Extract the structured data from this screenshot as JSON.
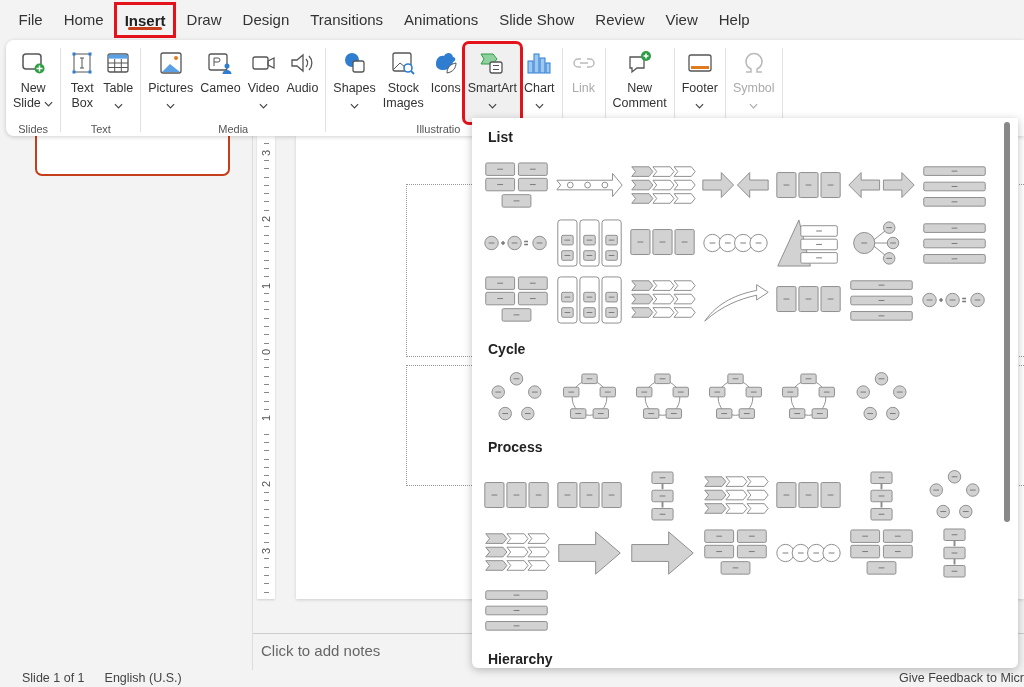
{
  "tabs": [
    {
      "label": "File",
      "selected": false,
      "annotated": false
    },
    {
      "label": "Home",
      "selected": false,
      "annotated": false
    },
    {
      "label": "Insert",
      "selected": true,
      "annotated": true
    },
    {
      "label": "Draw",
      "selected": false,
      "annotated": false
    },
    {
      "label": "Design",
      "selected": false,
      "annotated": false
    },
    {
      "label": "Transitions",
      "selected": false,
      "annotated": false
    },
    {
      "label": "Animations",
      "selected": false,
      "annotated": false
    },
    {
      "label": "Slide Show",
      "selected": false,
      "annotated": false
    },
    {
      "label": "Review",
      "selected": false,
      "annotated": false
    },
    {
      "label": "View",
      "selected": false,
      "annotated": false
    },
    {
      "label": "Help",
      "selected": false,
      "annotated": false
    }
  ],
  "ribbon": {
    "groups": [
      {
        "label": "Slides",
        "buttons": [
          {
            "label": "New\nSlide",
            "dropdown": true,
            "disabled": false,
            "pressed": false,
            "annotated": false
          }
        ]
      },
      {
        "label": "Text",
        "buttons": [
          {
            "label": "Text\nBox",
            "dropdown": false,
            "disabled": false,
            "pressed": false,
            "annotated": false
          },
          {
            "label": "Table",
            "dropdown": true,
            "disabled": false,
            "pressed": false,
            "annotated": false
          }
        ]
      },
      {
        "label": "Media",
        "buttons": [
          {
            "label": "Pictures",
            "dropdown": true,
            "disabled": false,
            "pressed": false,
            "annotated": false
          },
          {
            "label": "Cameo",
            "dropdown": false,
            "disabled": false,
            "pressed": false,
            "annotated": false
          },
          {
            "label": "Video",
            "dropdown": true,
            "disabled": false,
            "pressed": false,
            "annotated": false
          },
          {
            "label": "Audio",
            "dropdown": false,
            "disabled": false,
            "pressed": false,
            "annotated": false
          }
        ]
      },
      {
        "label": "Illustratio",
        "buttons": [
          {
            "label": "Shapes",
            "dropdown": true,
            "disabled": false,
            "pressed": false,
            "annotated": false
          },
          {
            "label": "Stock\nImages",
            "dropdown": false,
            "disabled": false,
            "pressed": false,
            "annotated": false
          },
          {
            "label": "Icons",
            "dropdown": false,
            "disabled": false,
            "pressed": false,
            "annotated": false
          },
          {
            "label": "SmartArt",
            "dropdown": true,
            "disabled": false,
            "pressed": true,
            "annotated": true
          },
          {
            "label": "Chart",
            "dropdown": true,
            "disabled": false,
            "pressed": false,
            "annotated": false
          }
        ]
      },
      {
        "buttons": [
          {
            "label": "Link",
            "dropdown": false,
            "disabled": true,
            "pressed": false,
            "annotated": false
          }
        ]
      },
      {
        "buttons": [
          {
            "label": "New\nComment",
            "dropdown": false,
            "disabled": false,
            "pressed": false,
            "annotated": false
          }
        ]
      },
      {
        "buttons": [
          {
            "label": "Footer",
            "dropdown": true,
            "disabled": false,
            "pressed": false,
            "annotated": false
          }
        ]
      },
      {
        "buttons": [
          {
            "label": "Symbol",
            "dropdown": true,
            "disabled": true,
            "pressed": false,
            "annotated": false
          }
        ]
      }
    ]
  },
  "gallery": {
    "sections": [
      {
        "title": "List",
        "items": [
          {
            "kind": "grid"
          },
          {
            "kind": "timeline"
          },
          {
            "kind": "chevrons"
          },
          {
            "kind": "facing"
          },
          {
            "kind": "boxes"
          },
          {
            "kind": "apart"
          },
          {
            "kind": "bars"
          },
          {
            "kind": "equation"
          },
          {
            "kind": "columns"
          },
          {
            "kind": "boxes"
          },
          {
            "kind": "circles"
          },
          {
            "kind": "pyramid"
          },
          {
            "kind": "hub"
          },
          {
            "kind": "bars"
          },
          {
            "kind": "grid"
          },
          {
            "kind": "columns"
          },
          {
            "kind": "chevrons"
          },
          {
            "kind": "curve"
          },
          {
            "kind": "boxes"
          },
          {
            "kind": "bars"
          },
          {
            "kind": "equation"
          }
        ]
      },
      {
        "title": "Cycle",
        "items": [
          {
            "kind": "ring"
          },
          {
            "kind": "boxring"
          },
          {
            "kind": "boxring"
          },
          {
            "kind": "boxring"
          },
          {
            "kind": "boxring"
          },
          {
            "kind": "ring"
          }
        ]
      },
      {
        "title": "Process",
        "items": [
          {
            "kind": "boxes"
          },
          {
            "kind": "boxes"
          },
          {
            "kind": "vflow"
          },
          {
            "kind": "chevrons"
          },
          {
            "kind": "boxes"
          },
          {
            "kind": "vflow"
          },
          {
            "kind": "ring"
          },
          {
            "kind": "chevrons"
          },
          {
            "kind": "bigarrow"
          },
          {
            "kind": "bigarrow"
          },
          {
            "kind": "grid"
          },
          {
            "kind": "circles"
          },
          {
            "kind": "grid"
          },
          {
            "kind": "vflow"
          },
          {
            "kind": "bars"
          }
        ]
      },
      {
        "title": "Hierarchy"
      }
    ]
  },
  "workspace": {
    "ruler": {
      "labels": [
        "3",
        "2",
        "1",
        "0",
        "1",
        "2",
        "3"
      ]
    },
    "notes": {
      "placeholder": "Click to add notes"
    }
  },
  "status_bar": {
    "items": [
      "Slide 1 of 1",
      "English (U.S.)"
    ],
    "feedback": "Give Feedback to Micr"
  }
}
